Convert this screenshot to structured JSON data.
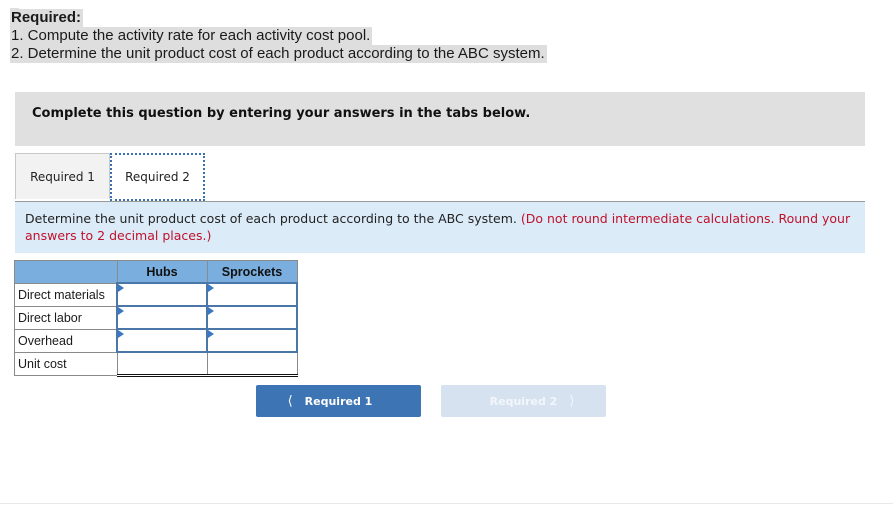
{
  "required": {
    "heading": "Required:",
    "items": [
      "1. Compute the activity rate for each activity cost pool.",
      "2. Determine the unit product cost of each product according to the ABC system."
    ]
  },
  "instruction": "Complete this question by entering your answers in the tabs below.",
  "tabs": [
    {
      "label": "Required 1",
      "active": false
    },
    {
      "label": "Required 2",
      "active": true
    }
  ],
  "description": {
    "main": "Determine the unit product cost of each product according to the ABC system.",
    "note": "(Do not round intermediate calculations. Round your answers to 2 decimal places.)"
  },
  "table": {
    "columns": [
      "",
      "Hubs",
      "Sprockets"
    ],
    "rows": [
      {
        "label": "Direct materials",
        "values": [
          "",
          ""
        ],
        "editable": true
      },
      {
        "label": "Direct labor",
        "values": [
          "",
          ""
        ],
        "editable": true
      },
      {
        "label": "Overhead",
        "values": [
          "",
          ""
        ],
        "editable": true
      },
      {
        "label": "Unit cost",
        "values": [
          "",
          ""
        ],
        "editable": false
      }
    ]
  },
  "nav": {
    "prev_label": "Required 1",
    "next_label": "Required 2",
    "prev_icon": "chevron-left-icon",
    "next_icon": "chevron-right-icon",
    "next_disabled": true
  },
  "colors": {
    "accent": "#3d74b4",
    "header_blue": "#7aaedf",
    "note_red": "#c0112b",
    "desc_bg": "#dcebf8"
  }
}
